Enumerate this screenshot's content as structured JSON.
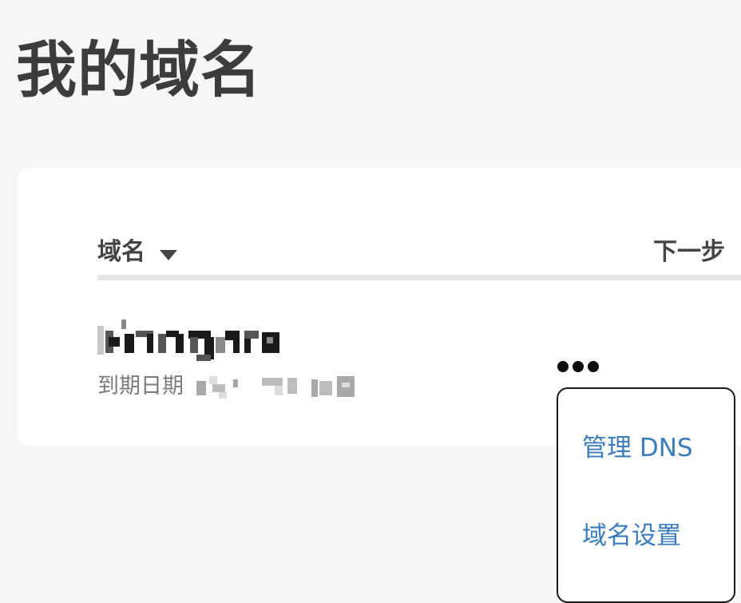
{
  "page": {
    "title": "我的域名"
  },
  "table": {
    "columns": {
      "domain": "域名",
      "next_step": "下一步"
    },
    "rows": [
      {
        "domain_name": "[redacted]",
        "expiry_label": "到期日期",
        "expiry_value": "[redacted]"
      }
    ]
  },
  "menu": {
    "items": [
      {
        "label": "管理 DNS"
      },
      {
        "label": "域名设置"
      }
    ]
  },
  "icons": {
    "sort": "caret-down-icon",
    "more": "ellipsis-horizontal-icon"
  },
  "colors": {
    "background": "#f5f6f8",
    "card": "#ffffff",
    "title_text": "#3c3c3c",
    "link": "#3a7cbf",
    "muted": "#7b7b7b"
  }
}
